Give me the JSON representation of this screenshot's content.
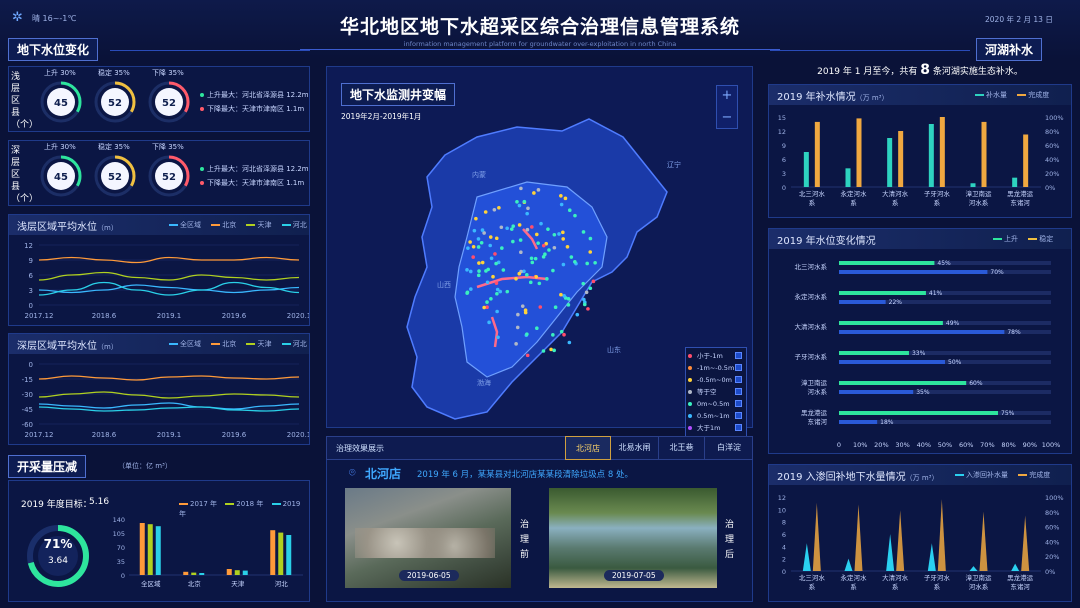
{
  "header": {
    "title": "华北地区地下水超采区综合治理信息管理系统",
    "subtitle": "information management platform for groundwater over-exploitation in north China",
    "weather": "晴 16~-1℃",
    "date": "2020 年 2 月 13 日"
  },
  "left": {
    "section1": "地下水位变化",
    "shallow_label": "浅层区县（个）",
    "deep_label": "深层区县（个）",
    "gauge_titles": [
      "上升 30%",
      "稳定 35%",
      "下降 35%"
    ],
    "gauge_values": [
      "45",
      "52",
      "52"
    ],
    "rise_max": "上升最大：河北省泽源县  12.2m",
    "fall_max": "下降最大：天津市津南区  1.1m",
    "shallow_chart": {
      "title": "浅层区域平均水位",
      "unit": "（m）",
      "legend": [
        "全区域",
        "北京",
        "天津",
        "河北"
      ],
      "yticks": [
        "12",
        "9",
        "6",
        "3",
        "0"
      ],
      "xticks": [
        "2017.12",
        "2018.6",
        "2019.1",
        "2019.6",
        "2020.1"
      ]
    },
    "deep_chart": {
      "title": "深层区域平均水位",
      "unit": "（m）",
      "legend": [
        "全区域",
        "北京",
        "天津",
        "河北"
      ],
      "yticks": [
        "0",
        "-15",
        "-30",
        "-45",
        "-60"
      ],
      "xticks": [
        "2017.12",
        "2018.6",
        "2019.1",
        "2019.6",
        "2020.1"
      ]
    },
    "section2": "开采量压减",
    "section2_unit": "（单位：亿 m³）",
    "target_label": "2019 年度目标：",
    "target_value": "5.16",
    "ring_pct": "71%",
    "ring_val": "3.64",
    "ring_fraction": 0.71,
    "bar_legend": [
      "2017 年",
      "2018 年",
      "2019 年"
    ],
    "bar_yticks": [
      "140",
      "105",
      "70",
      "35",
      "0"
    ]
  },
  "center": {
    "map_title": "地下水监测井变幅",
    "map_period": "2019年2月-2019年1月",
    "map_regions": [
      "内蒙",
      "辽宁",
      "山西",
      "山东",
      "渤海"
    ],
    "legend": [
      {
        "label": "小于-1m",
        "color": "#ff4d6d"
      },
      {
        "label": "-1m~-0.5m",
        "color": "#ff8c3a"
      },
      {
        "label": "-0.5m~0m",
        "color": "#ffd23a"
      },
      {
        "label": "等于空",
        "color": "#b0b8c8"
      },
      {
        "label": "0m~0.5m",
        "color": "#3af0c0"
      },
      {
        "label": "0.5m~1m",
        "color": "#3ab8ff"
      },
      {
        "label": "大于1m",
        "color": "#b04dff"
      }
    ],
    "zoom_in": "+",
    "zoom_out": "−",
    "tab_header": "治理效果展示",
    "tabs": [
      "北河店",
      "北易水闸",
      "北王巷",
      "白洋淀"
    ],
    "place": "北河店",
    "place_desc": "2019 年 6 月，某某县对北河店某某段清除垃圾点 8 处。",
    "before_date": "2019-06-05",
    "after_date": "2019-07-05",
    "before_label": "治理前",
    "after_label": "治理后"
  },
  "right": {
    "section": "河湖补水",
    "summary_pre": "2019 年 1 月至今，共有",
    "summary_num": "8",
    "summary_post": "条河湖实施生态补水。",
    "chart1": {
      "title": "2019 年补水情况",
      "unit": "（万 m³）",
      "legend": [
        "补水量",
        "完成度"
      ],
      "yticks": [
        "15",
        "12",
        "9",
        "6",
        "3",
        "0"
      ],
      "y2ticks": [
        "100%",
        "80%",
        "60%",
        "40%",
        "20%",
        "0%"
      ],
      "categories": [
        "北三河水系",
        "永定河水系",
        "大清河水系",
        "子牙河水系",
        "漳卫南运河水系",
        "黑龙港运东诸河"
      ],
      "values": [
        7.5,
        4,
        10.5,
        13.5,
        0.8,
        2
      ],
      "completion": [
        93,
        98,
        80,
        100,
        93,
        75
      ]
    },
    "chart2": {
      "title": "2019 年水位变化情况",
      "legend": [
        "上升",
        "稳定"
      ],
      "rows": [
        {
          "name": "北三河水系",
          "up": "45%",
          "up_v": 0.45,
          "stable": "70%",
          "stable_v": 0.7
        },
        {
          "name": "永定河水系",
          "up": "41%",
          "up_v": 0.41,
          "stable": "22%",
          "stable_v": 0.22
        },
        {
          "name": "大清河水系",
          "up": "49%",
          "up_v": 0.49,
          "stable": "78%",
          "stable_v": 0.78
        },
        {
          "name": "子牙河水系",
          "up": "33%",
          "up_v": 0.33,
          "stable": "50%",
          "stable_v": 0.5
        },
        {
          "name": "漳卫南运河水系",
          "up": "60%",
          "up_v": 0.6,
          "stable": "35%",
          "stable_v": 0.35
        },
        {
          "name": "黑龙港运东诸河",
          "up": "75%",
          "up_v": 0.75,
          "stable": "18%",
          "stable_v": 0.18
        }
      ],
      "xticks": [
        "0",
        "10%",
        "20%",
        "30%",
        "40%",
        "50%",
        "60%",
        "70%",
        "80%",
        "90%",
        "100%"
      ]
    },
    "chart3": {
      "title": "2019 入渗回补地下水量情况",
      "unit": "（万 m³）",
      "legend": [
        "入渗回补水量",
        "完成度"
      ],
      "yticks": [
        "12",
        "10",
        "8",
        "6",
        "4",
        "2",
        "0"
      ],
      "y2ticks": [
        "100%",
        "80%",
        "60%",
        "40%",
        "20%",
        "0%"
      ],
      "categories": [
        "北三河水系",
        "永定河水系",
        "大清河水系",
        "子牙河水系",
        "漳卫南运河水系",
        "黑龙港运东诸河"
      ],
      "values": [
        4.5,
        2,
        6,
        4.5,
        0.8,
        1.2
      ],
      "completion": [
        92,
        90,
        82,
        97,
        80,
        75
      ]
    }
  },
  "bar_chart": {
    "categories": [
      "全区域",
      "北京",
      "天津",
      "河北"
    ],
    "series": [
      {
        "name": "2017 年",
        "values": [
          130,
          8,
          15,
          112
        ]
      },
      {
        "name": "2018 年",
        "values": [
          127,
          6,
          12,
          106
        ]
      },
      {
        "name": "2019 年",
        "values": [
          122,
          5,
          11,
          100
        ]
      }
    ]
  },
  "line_charts": {
    "shallow": [
      [
        9,
        9.5,
        9,
        8.5,
        9.5,
        9,
        9,
        9.5,
        9
      ],
      [
        5,
        6,
        6.5,
        5.5,
        5,
        6,
        5.5,
        5,
        5.5
      ],
      [
        3,
        2.5,
        3,
        4,
        3.5,
        3,
        2.5,
        3,
        3.5
      ],
      [
        2,
        3,
        4.5,
        3,
        2,
        3,
        4.5,
        3.5,
        2.5
      ]
    ],
    "deep": [
      [
        -15,
        -12,
        -14,
        -16,
        -13,
        -12,
        -14,
        -15,
        -13
      ],
      [
        -33,
        -30,
        -28,
        -31,
        -34,
        -32,
        -30,
        -31,
        -33
      ],
      [
        -40,
        -42,
        -44,
        -41,
        -39,
        -43,
        -45,
        -42,
        -40
      ],
      [
        -43,
        -45,
        -47,
        -46,
        -44,
        -43,
        -46,
        -47,
        -45
      ]
    ]
  }
}
